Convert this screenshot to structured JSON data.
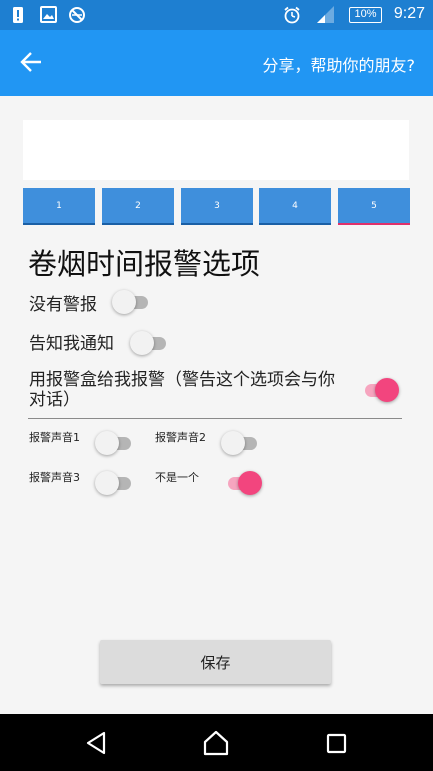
{
  "status_bar": {
    "time": "9:27",
    "battery": "10%",
    "icons": [
      "alert-icon",
      "image-icon",
      "blocked-icon",
      "alarm-icon",
      "signal-icon"
    ]
  },
  "app_bar": {
    "back_icon": "arrow-left-icon",
    "share_text": "分享，帮助你的朋友?"
  },
  "tabs": [
    {
      "label": "1",
      "active": false
    },
    {
      "label": "2",
      "active": false
    },
    {
      "label": "3",
      "active": false
    },
    {
      "label": "4",
      "active": false
    },
    {
      "label": "5",
      "active": true
    }
  ],
  "heading": "卷烟时间报警选项",
  "options": {
    "no_alarm": {
      "label": "没有警报",
      "on": false
    },
    "notify_me": {
      "label": "告知我通知",
      "on": false
    },
    "alarm_box": {
      "label": "用报警盒给我报警（警告这个选项会与你对话）",
      "on": true
    }
  },
  "sounds": {
    "sound1": {
      "label": "报警声音1",
      "on": false
    },
    "sound2": {
      "label": "报警声音2",
      "on": false
    },
    "sound3": {
      "label": "报警声音3",
      "on": false
    },
    "none": {
      "label": "不是一个",
      "on": true
    }
  },
  "save_label": "保存",
  "colors": {
    "status_bar": "#1e7fd1",
    "app_bar": "#2196f3",
    "tab": "#3f8fdc",
    "accent": "#f2457e"
  }
}
